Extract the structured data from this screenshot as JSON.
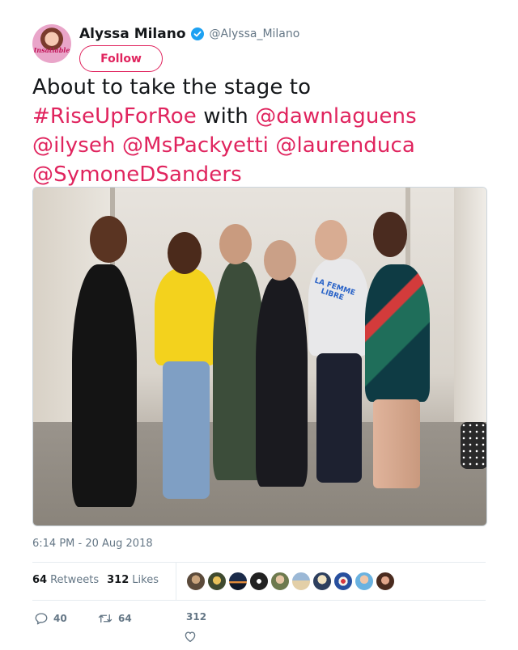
{
  "author": {
    "name": "Alyssa Milano",
    "handle": "@Alyssa_Milano",
    "avatar_text": "Insatiable",
    "follow_label": "Follow"
  },
  "tweet": {
    "text_prefix": "About to take the stage to",
    "hashtag": "#RiseUpForRoe",
    "with_word": "with",
    "mentions": [
      "@dawnlaguens",
      "@ilyseh",
      "@MsPackyetti",
      "@laurenduca",
      "@SymoneDSanders"
    ],
    "shirt_text": "LA FEMME LIBRE"
  },
  "timestamp": "6:14 PM - 20 Aug 2018",
  "stats": {
    "retweets_count": "64",
    "retweets_label": "Retweets",
    "likes_count": "312",
    "likes_label": "Likes"
  },
  "actions": {
    "reply_count": "40",
    "retweet_count": "64",
    "like_count": "312"
  },
  "colors": {
    "accent": "#e0245e",
    "verified": "#1da1f2",
    "muted": "#657786"
  }
}
